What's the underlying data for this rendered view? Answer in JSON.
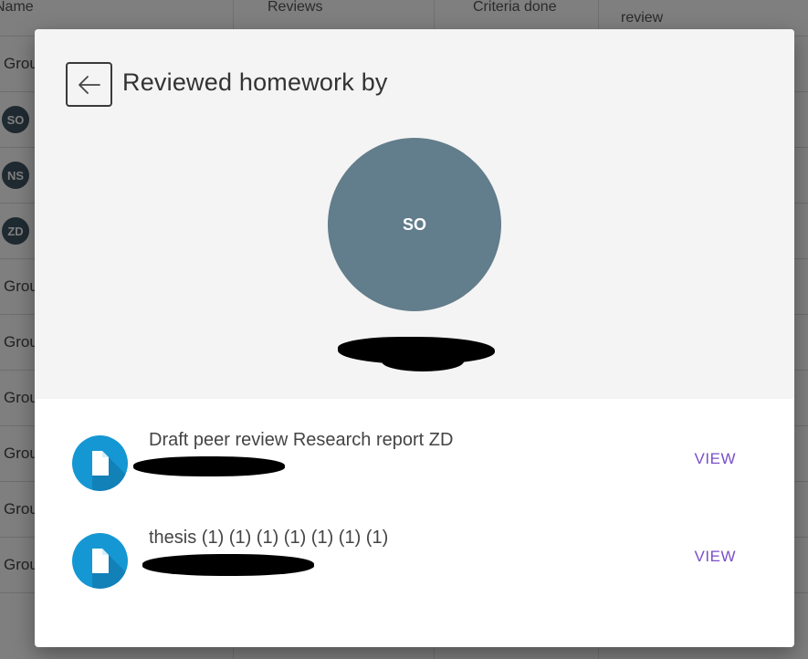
{
  "background_table": {
    "columns": [
      "Name",
      "Reviews",
      "Criteria done",
      "review"
    ],
    "rows": [
      {
        "type": "text",
        "label": "Grou"
      },
      {
        "type": "avatar",
        "label": "SO"
      },
      {
        "type": "avatar",
        "label": "NS"
      },
      {
        "type": "avatar",
        "label": "ZD"
      },
      {
        "type": "text",
        "label": "Grou"
      },
      {
        "type": "text",
        "label": "Grou"
      },
      {
        "type": "text",
        "label": "Grou"
      },
      {
        "type": "text",
        "label": "Grou"
      },
      {
        "type": "text",
        "label": "Grou"
      },
      {
        "type": "text",
        "label": "Grou"
      }
    ]
  },
  "dialog": {
    "back_icon": "arrow-left-icon",
    "title": "Reviewed homework by",
    "avatar": {
      "initials": "SO",
      "color": "#627d8b"
    },
    "reviewer_name_redacted": true,
    "items": [
      {
        "icon": "file-icon",
        "title": "Draft peer review Research report ZD",
        "subtitle_redacted": true,
        "action": "VIEW"
      },
      {
        "icon": "file-icon",
        "title": "thesis (1) (1) (1) (1) (1) (1) (1)",
        "subtitle_redacted": true,
        "action": "VIEW"
      }
    ]
  },
  "colors": {
    "accent": "#7b4fc9",
    "file_icon": "#1597d3",
    "avatar": "#627d8b"
  }
}
